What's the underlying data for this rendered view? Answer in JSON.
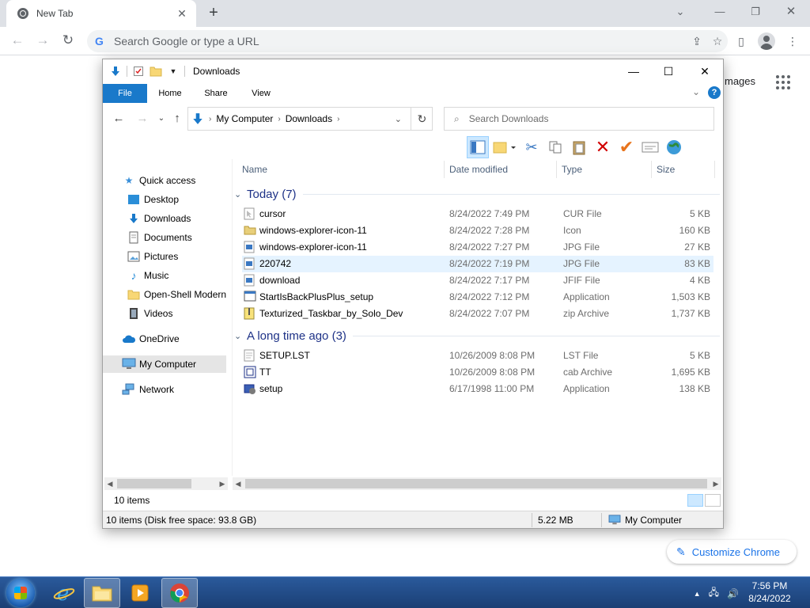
{
  "chrome": {
    "tab_title": "New Tab",
    "omnibox_placeholder": "Search Google or type a URL",
    "google_letter": "G",
    "ntp_images_link": "mages",
    "customize_label": "Customize Chrome"
  },
  "explorer": {
    "title": "Downloads",
    "ribbon_tabs": [
      "File",
      "Home",
      "Share",
      "View"
    ],
    "help_label": "?",
    "breadcrumb": [
      "My Computer",
      "Downloads"
    ],
    "search_placeholder": "Search Downloads",
    "nav": {
      "quick_access": "Quick access",
      "pinned": [
        "Desktop",
        "Downloads",
        "Documents",
        "Pictures"
      ],
      "unpinned": [
        "Music",
        "Open-Shell Modern",
        "Videos"
      ],
      "onedrive": "OneDrive",
      "my_computer": "My Computer",
      "network": "Network"
    },
    "columns": {
      "name": "Name",
      "date": "Date modified",
      "type": "Type",
      "size": "Size"
    },
    "groups": [
      {
        "label": "Today (7)",
        "files": [
          {
            "name": "cursor",
            "date": "8/24/2022 7:49 PM",
            "type": "CUR File",
            "size": "5 KB",
            "icon": "cursor-file-icon"
          },
          {
            "name": "windows-explorer-icon-11",
            "date": "8/24/2022 7:28 PM",
            "type": "Icon",
            "size": "160 KB",
            "icon": "folder-icon-file-icon"
          },
          {
            "name": "windows-explorer-icon-11",
            "date": "8/24/2022 7:27 PM",
            "type": "JPG File",
            "size": "27 KB",
            "icon": "image-file-icon"
          },
          {
            "name": "220742",
            "date": "8/24/2022 7:19 PM",
            "type": "JPG File",
            "size": "83 KB",
            "icon": "image-file-icon"
          },
          {
            "name": "download",
            "date": "8/24/2022 7:17 PM",
            "type": "JFIF File",
            "size": "4 KB",
            "icon": "image-file-icon"
          },
          {
            "name": "StartIsBackPlusPlus_setup",
            "date": "8/24/2022 7:12 PM",
            "type": "Application",
            "size": "1,503 KB",
            "icon": "application-icon"
          },
          {
            "name": "Texturized_Taskbar_by_Solo_Dev",
            "date": "8/24/2022 7:07 PM",
            "type": "zip Archive",
            "size": "1,737 KB",
            "icon": "zip-archive-icon"
          }
        ]
      },
      {
        "label": "A long time ago (3)",
        "files": [
          {
            "name": "SETUP.LST",
            "date": "10/26/2009 8:08 PM",
            "type": "LST File",
            "size": "5 KB",
            "icon": "text-file-icon"
          },
          {
            "name": "TT",
            "date": "10/26/2009 8:08 PM",
            "type": "cab Archive",
            "size": "1,695 KB",
            "icon": "cab-archive-icon"
          },
          {
            "name": "setup",
            "date": "6/17/1998 11:00 PM",
            "type": "Application",
            "size": "138 KB",
            "icon": "setup-application-icon"
          }
        ]
      }
    ],
    "item_count": "10 items",
    "status_info": "10 items (Disk free space: 93.8 GB)",
    "status_size": "5.22 MB",
    "status_location": "My Computer"
  },
  "taskbar": {
    "time": "7:56 PM",
    "date": "8/24/2022"
  },
  "colors": {
    "ribbon_blue": "#1979ca",
    "selection": "#cce8ff",
    "group_header": "#1e3287",
    "chrome_link": "#1a73e8"
  }
}
